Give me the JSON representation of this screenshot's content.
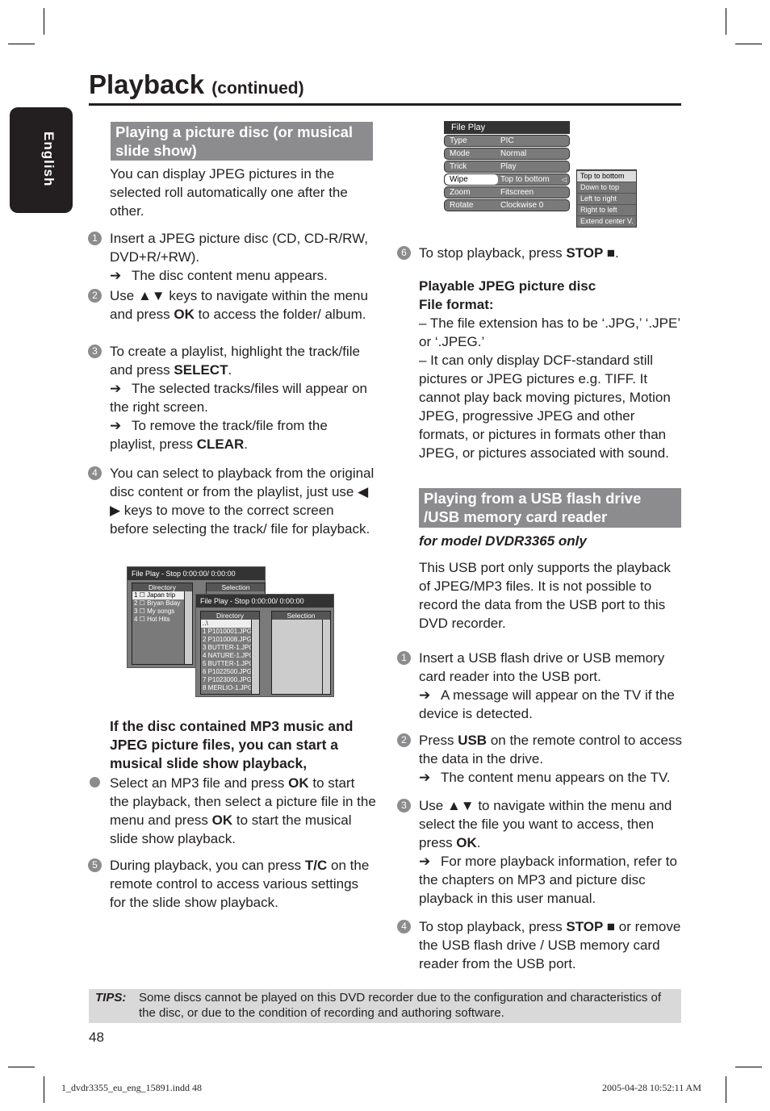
{
  "header": {
    "title": "Playback",
    "subtitle": "(continued)",
    "language_tab": "English"
  },
  "left": {
    "heading": "Playing a picture disc (or musical slide show)",
    "intro": "You can display JPEG pictures in the selected roll automatically one after the other.",
    "step1": {
      "num": "1",
      "text": "Insert a JPEG picture disc (CD, CD-R/RW, DVD+R/+RW).",
      "result": "The disc content menu appears."
    },
    "step2": {
      "num": "2",
      "a": "Use ▲▼ keys to navigate within the menu and press ",
      "b": "OK",
      "c": " to access the folder/ album."
    },
    "step3": {
      "num": "3",
      "a": "To create a playlist, highlight the track/file and press ",
      "b": "SELECT",
      "c": ".",
      "r1": "The selected tracks/files will appear on the right screen.",
      "r2a": "To remove the track/file from the playlist, press ",
      "r2b": "CLEAR",
      "r2c": "."
    },
    "step4": {
      "num": "4",
      "text": "You can select to playback from the original disc content or from the playlist, just use ◀ ▶ keys to move to the correct screen before selecting the track/ file for playback."
    },
    "mp3_heading": "If the disc contained MP3 music and JPEG picture files, you can start a musical slide show playback,",
    "bullet": {
      "a": "Select an MP3 file and press ",
      "b": "OK",
      "c": " to start the playback, then select a picture file in the menu and press ",
      "d": "OK",
      "e": " to start the musical slide show playback."
    },
    "step5": {
      "num": "5",
      "a": "During playback, you can press ",
      "b": "T/C",
      "c": " on the remote control to access various settings for the slide show playback."
    }
  },
  "screens": {
    "back": {
      "title": "File Play - Stop 0:00:00/ 0:00:00",
      "dir": "Directory",
      "sel": "Selection",
      "items": [
        "1 ☐ Japan trip",
        "2 ☐ Bryan Bday",
        "3 ☐ My songs",
        "4 ☐ Hot Hits"
      ]
    },
    "front": {
      "title": "File Play - Stop 0:00:00/ 0:00:00",
      "dir": "Directory",
      "sel": "Selection",
      "items": [
        "..\\",
        "1    P1010001.JPG",
        "2    P1010008.JPG",
        "3    BUTTER-1.JPG",
        "4    NATURE-1.JPG",
        "5    BUTTER-1.JPG",
        "6    P1022500.JPG",
        "7    P1023000.JPG",
        "8    MERLIO-1.JPG"
      ]
    }
  },
  "file_play_menu": {
    "title": "File Play",
    "rows": [
      {
        "k": "Type",
        "v": "PIC"
      },
      {
        "k": "Mode",
        "v": "Normal"
      },
      {
        "k": "Trick",
        "v": "Play"
      },
      {
        "k": "Wipe",
        "v": "Top to bottom"
      },
      {
        "k": "Zoom",
        "v": "Fitscreen"
      },
      {
        "k": "Rotate",
        "v": "Clockwise 0"
      }
    ],
    "submenu": [
      "Top to bottom",
      "Down to top",
      "Left to right",
      "Right to left",
      "Extend center V."
    ]
  },
  "right": {
    "step6": {
      "num": "6",
      "a": "To stop playback, press ",
      "b": "STOP ■",
      "c": "."
    },
    "jpeg_heading1": "Playable JPEG picture disc",
    "jpeg_heading2": "File format:",
    "fmt1": "–  The file extension has to be ‘.JPG,’ ‘.JPE’ or ‘.JPEG.’",
    "fmt2": "–  It can only display DCF-standard still pictures or JPEG pictures e.g. TIFF. It cannot play back moving pictures, Motion JPEG, progressive JPEG and other formats, or pictures in formats other than JPEG, or pictures associated with sound.",
    "usb_heading": "Playing from a USB flash drive /USB memory card reader",
    "model": "for model DVDR3365 only",
    "usb_intro": "This USB port only supports the playback of JPEG/MP3 files. It is not possible to record the data from the USB port to this DVD recorder.",
    "u1": {
      "num": "1",
      "text": "Insert a USB flash drive or USB memory card reader into the USB port.",
      "r": "A message will appear on the TV if the device is detected."
    },
    "u2": {
      "num": "2",
      "a": "Press ",
      "b": "USB",
      "c": " on the remote control to access the data in the drive.",
      "r": "The content menu appears on the TV."
    },
    "u3": {
      "num": "3",
      "a": "Use ▲▼ to navigate within the menu and select the file you want to access, then press ",
      "b": "OK",
      "c": ".",
      "r": "For more playback information, refer to the chapters on MP3 and picture disc playback in this user manual."
    },
    "u4": {
      "num": "4",
      "a": "To stop playback, press ",
      "b": "STOP ■",
      "c": " or remove the USB flash drive / USB memory card reader from the USB port."
    }
  },
  "tips": {
    "label": "TIPS:",
    "text": "Some discs cannot be played on this DVD recorder due to the configuration and characteristics of the disc, or due to the condition of recording and authoring software."
  },
  "page_number": "48",
  "footer": {
    "file": "1_dvdr3355_eu_eng_15891.indd   48",
    "date": "2005-04-28   10:52:11 AM"
  },
  "arrow": "➔"
}
